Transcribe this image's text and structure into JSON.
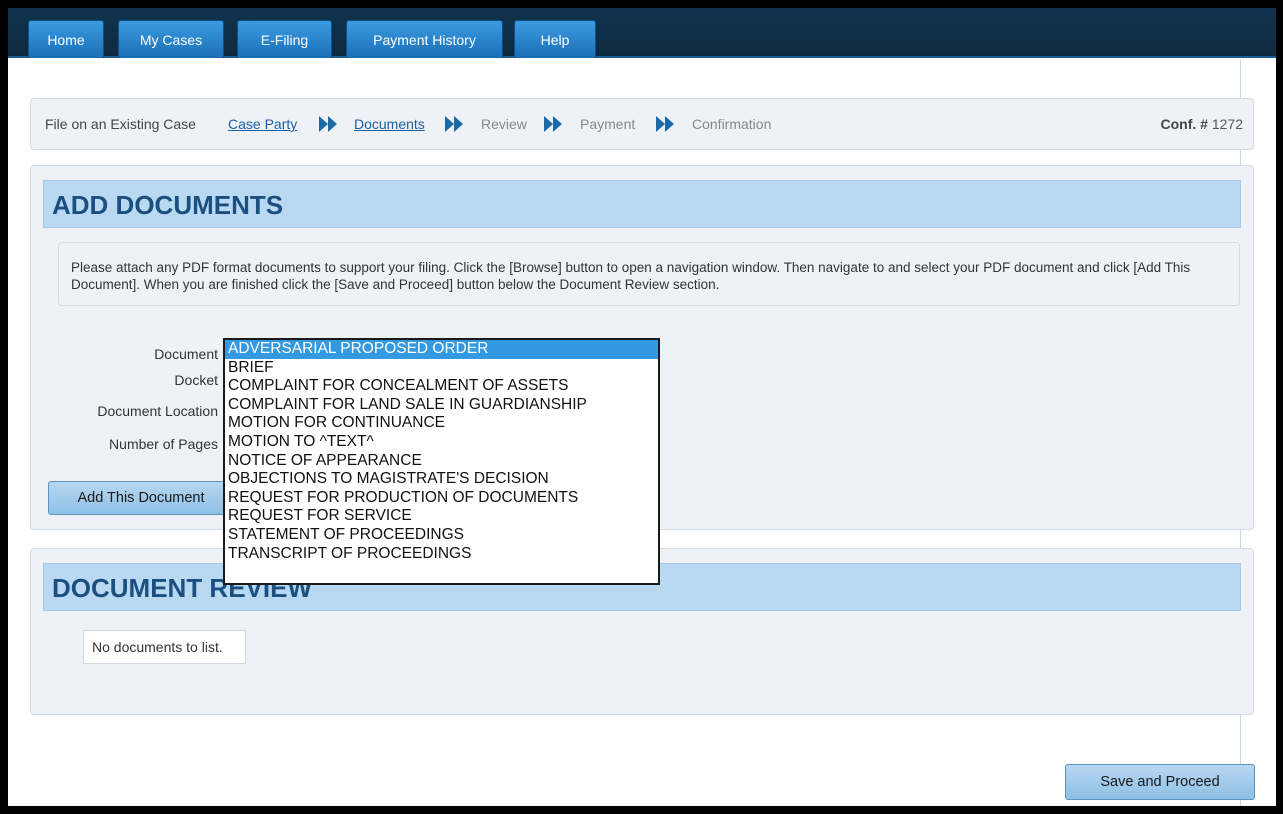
{
  "nav": {
    "tabs": [
      "Home",
      "My Cases",
      "E-Filing",
      "Payment History",
      "Help"
    ]
  },
  "wizard": {
    "prefix": "File on an Existing Case",
    "steps": [
      {
        "label": "Case Party",
        "state": "link"
      },
      {
        "label": "Documents",
        "state": "link"
      },
      {
        "label": "Review",
        "state": "off"
      },
      {
        "label": "Payment",
        "state": "off"
      },
      {
        "label": "Confirmation",
        "state": "off"
      }
    ],
    "conf_label": "Conf. #",
    "conf_value": "1272"
  },
  "add_documents": {
    "title": "ADD DOCUMENTS",
    "instructions": "Please attach any PDF format documents to support your filing. Click the [Browse] button to open a navigation window. Then navigate to and select your PDF document and click [Add This Document]. When you are finished click the [Save and Proceed] button below the Document Review section.",
    "labels": {
      "document": "Document",
      "docket": "Docket",
      "location": "Document Location",
      "pages": "Number of Pages"
    },
    "add_button": "Add This Document"
  },
  "document_dropdown": {
    "selected_index": 0,
    "options": [
      "ADVERSARIAL PROPOSED ORDER",
      "BRIEF",
      "COMPLAINT FOR CONCEALMENT OF ASSETS",
      "COMPLAINT FOR LAND SALE IN GUARDIANSHIP",
      "MOTION FOR CONTINUANCE",
      "MOTION TO ^TEXT^",
      "NOTICE OF APPEARANCE",
      "OBJECTIONS TO MAGISTRATE'S DECISION",
      "REQUEST FOR PRODUCTION OF DOCUMENTS",
      "REQUEST FOR SERVICE",
      "STATEMENT OF PROCEEDINGS",
      "TRANSCRIPT OF PROCEEDINGS"
    ]
  },
  "document_review": {
    "title": "DOCUMENT REVIEW",
    "empty_text": "No documents to list."
  },
  "footer": {
    "save_button": "Save and Proceed"
  },
  "colors": {
    "nav_tab": "#1a6fb8",
    "header_band": "#b9d9f3",
    "header_text": "#1b4f80",
    "selected_option": "#3399e0",
    "link": "#1a5fa8"
  }
}
